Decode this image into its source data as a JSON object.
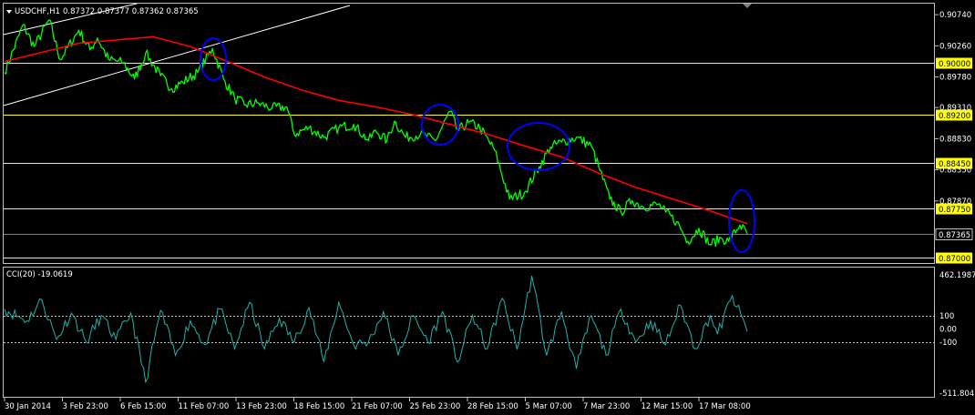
{
  "header": {
    "symbol": "USDCHF,H1",
    "ohlc": "0.87372 0.87377 0.87362 0.87365"
  },
  "indicator": {
    "label": "CCI(20) -19.0619",
    "axis_labels": [
      "462.1987",
      "100",
      "0.00",
      "-100",
      "-511.8047"
    ]
  },
  "colors": {
    "background": "#000000",
    "price": "#00ff00",
    "moving_average": "#ff0000",
    "horizontal_lines": "#ffff00",
    "last_price_line": "#6f7f9f",
    "ellipses": "#0000ff",
    "channel": "#ffffff",
    "cci": "#20b2aa",
    "axis_border": "#c0c0c0"
  },
  "chart_data": [
    {
      "type": "line",
      "title": "USDCHF,H1",
      "x_tick_labels": [
        "30 Jan 2014",
        "3 Feb 23:00",
        "6 Feb 15:00",
        "11 Feb 07:00",
        "13 Feb 23:00",
        "18 Feb 15:00",
        "21 Feb 07:00",
        "25 Feb 23:00",
        "28 Feb 15:00",
        "5 Mar 07:00",
        "7 Mar 23:00",
        "12 Mar 15:00",
        "17 Mar 08:00"
      ],
      "y_tick_labels": [
        "0.90740",
        "0.90260",
        "0.89780",
        "0.89310",
        "0.88830",
        "0.88350",
        "0.87870"
      ],
      "ylim": [
        0.86915,
        0.9091
      ],
      "horizontal_lines": [
        {
          "value": 0.9,
          "label": "0.90000"
        },
        {
          "value": 0.892,
          "label": "0.89200"
        },
        {
          "value": 0.8845,
          "label": "0.88450"
        },
        {
          "value": 0.8775,
          "label": "0.87750"
        },
        {
          "value": 0.87,
          "label": "0.87000"
        }
      ],
      "last_price": {
        "value": 0.87365,
        "label": "0.87365"
      },
      "series": [
        {
          "x": [
            0,
            0.025,
            0.04,
            0.06,
            0.075,
            0.1,
            0.115,
            0.125,
            0.14,
            0.16,
            0.175,
            0.19,
            0.21,
            0.225,
            0.24,
            0.26,
            0.28,
            0.295,
            0.31,
            0.325,
            0.34,
            0.36,
            0.38,
            0.39,
            0.41,
            0.43,
            0.45,
            0.47,
            0.49,
            0.5,
            0.515,
            0.525,
            0.54,
            0.56,
            0.58,
            0.6,
            0.61,
            0.625,
            0.64,
            0.66,
            0.68,
            0.7,
            0.72,
            0.735,
            0.75,
            0.77,
            0.79,
            0.8,
            0.815,
            0.83,
            0.845,
            0.86,
            0.88,
            0.89,
            0.905,
            0.92,
            0.935,
            0.95,
            0.965,
            0.975,
            0.99,
            1.0
          ],
          "values": [
            0.8985,
            0.9058,
            0.9025,
            0.9066,
            0.9005,
            0.905,
            0.902,
            0.9038,
            0.9005,
            0.9,
            0.8975,
            0.9015,
            0.898,
            0.896,
            0.897,
            0.8985,
            0.9022,
            0.8975,
            0.8945,
            0.8935,
            0.8938,
            0.893,
            0.8932,
            0.889,
            0.89,
            0.8885,
            0.89,
            0.8905,
            0.888,
            0.8895,
            0.888,
            0.891,
            0.8885,
            0.889,
            0.888,
            0.8925,
            0.8895,
            0.8908,
            0.89,
            0.8865,
            0.879,
            0.88,
            0.884,
            0.887,
            0.8878,
            0.8885,
            0.8872,
            0.884,
            0.879,
            0.877,
            0.8788,
            0.8778,
            0.8782,
            0.877,
            0.8755,
            0.8725,
            0.8745,
            0.872,
            0.873,
            0.8725,
            0.875,
            0.87365
          ]
        },
        {
          "x": [
            0,
            0.1,
            0.2,
            0.25,
            0.3,
            0.35,
            0.4,
            0.45,
            0.5,
            0.55,
            0.6,
            0.65,
            0.7,
            0.75,
            0.8,
            0.85,
            0.9,
            0.95,
            1.0
          ],
          "values": [
            0.9002,
            0.903,
            0.904,
            0.9025,
            0.9002,
            0.8978,
            0.8958,
            0.8942,
            0.8932,
            0.892,
            0.8905,
            0.889,
            0.8872,
            0.8855,
            0.883,
            0.8808,
            0.879,
            0.8772,
            0.8752
          ]
        }
      ]
    },
    {
      "type": "line",
      "title": "CCI(20) -19.0619",
      "ylim": [
        -511.8047,
        462.1987
      ],
      "reference_lines": [
        100,
        -100
      ],
      "series": [
        {
          "x": [
            0,
            0.03,
            0.05,
            0.07,
            0.09,
            0.11,
            0.13,
            0.15,
            0.17,
            0.19,
            0.21,
            0.23,
            0.25,
            0.27,
            0.29,
            0.31,
            0.33,
            0.35,
            0.37,
            0.39,
            0.41,
            0.43,
            0.45,
            0.47,
            0.49,
            0.51,
            0.53,
            0.55,
            0.57,
            0.59,
            0.61,
            0.63,
            0.65,
            0.67,
            0.69,
            0.71,
            0.73,
            0.75,
            0.77,
            0.79,
            0.81,
            0.83,
            0.85,
            0.87,
            0.89,
            0.91,
            0.93,
            0.95,
            0.96,
            0.98,
            1.0
          ],
          "values": [
            150,
            60,
            220,
            -80,
            120,
            -100,
            100,
            -80,
            120,
            -400,
            140,
            -200,
            60,
            -120,
            150,
            -150,
            200,
            -150,
            80,
            -100,
            160,
            -250,
            200,
            -120,
            -100,
            130,
            -200,
            100,
            -100,
            130,
            -250,
            100,
            -150,
            230,
            -150,
            400,
            -200,
            130,
            -300,
            100,
            -200,
            150,
            -100,
            60,
            -120,
            180,
            -150,
            100,
            -40,
            250,
            -19
          ]
        }
      ]
    }
  ]
}
